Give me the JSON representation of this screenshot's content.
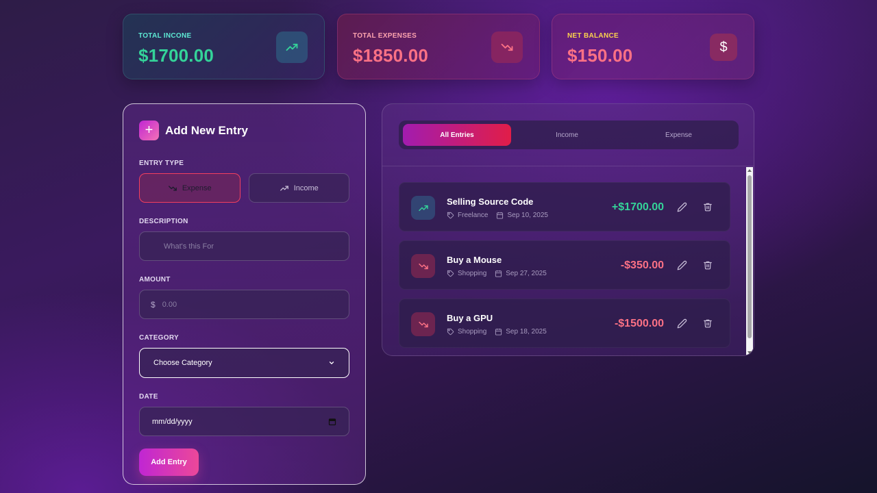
{
  "stats": {
    "income": {
      "label": "TOTAL INCONE",
      "value": "$1700.00",
      "icon": "trending-up-icon"
    },
    "expenses": {
      "label": "TOTAL EXPENSES",
      "value": "$1850.00",
      "icon": "trending-down-icon"
    },
    "balance": {
      "label": "NET BALANCE",
      "value": "$150.00",
      "icon": "dollar-icon",
      "symbol": "$"
    }
  },
  "form": {
    "title": "Add New Entry",
    "entry_type_label": "ENTRY TYPE",
    "type_expense": "Expense",
    "type_income": "Income",
    "description_label": "DESCRIPTION",
    "description_placeholder": "What's this For",
    "amount_label": "AMOUNT",
    "amount_prefix": "$",
    "amount_placeholder": "0.00",
    "category_label": "CATEGORY",
    "category_selected": "Choose Category",
    "date_label": "DATE",
    "date_placeholder": "mm/dd/yyyy",
    "submit_label": "Add Entry"
  },
  "tabs": [
    {
      "label": "All Entries",
      "active": true
    },
    {
      "label": "Income",
      "active": false
    },
    {
      "label": "Expense",
      "active": false
    }
  ],
  "entries": [
    {
      "title": "Selling Source Code",
      "category": "Freelance",
      "date": "Sep 10, 2025",
      "amount": "+$1700.00",
      "type": "income"
    },
    {
      "title": "Buy a Mouse",
      "category": "Shopping",
      "date": "Sep 27, 2025",
      "amount": "-$350.00",
      "type": "expense"
    },
    {
      "title": "Buy a GPU",
      "category": "Shopping",
      "date": "Sep 18, 2025",
      "amount": "-$1500.00",
      "type": "expense"
    }
  ],
  "colors": {
    "income": "#34d399",
    "expense": "#fb7185",
    "accent_start": "#c026d3",
    "accent_end": "#ec4899"
  }
}
